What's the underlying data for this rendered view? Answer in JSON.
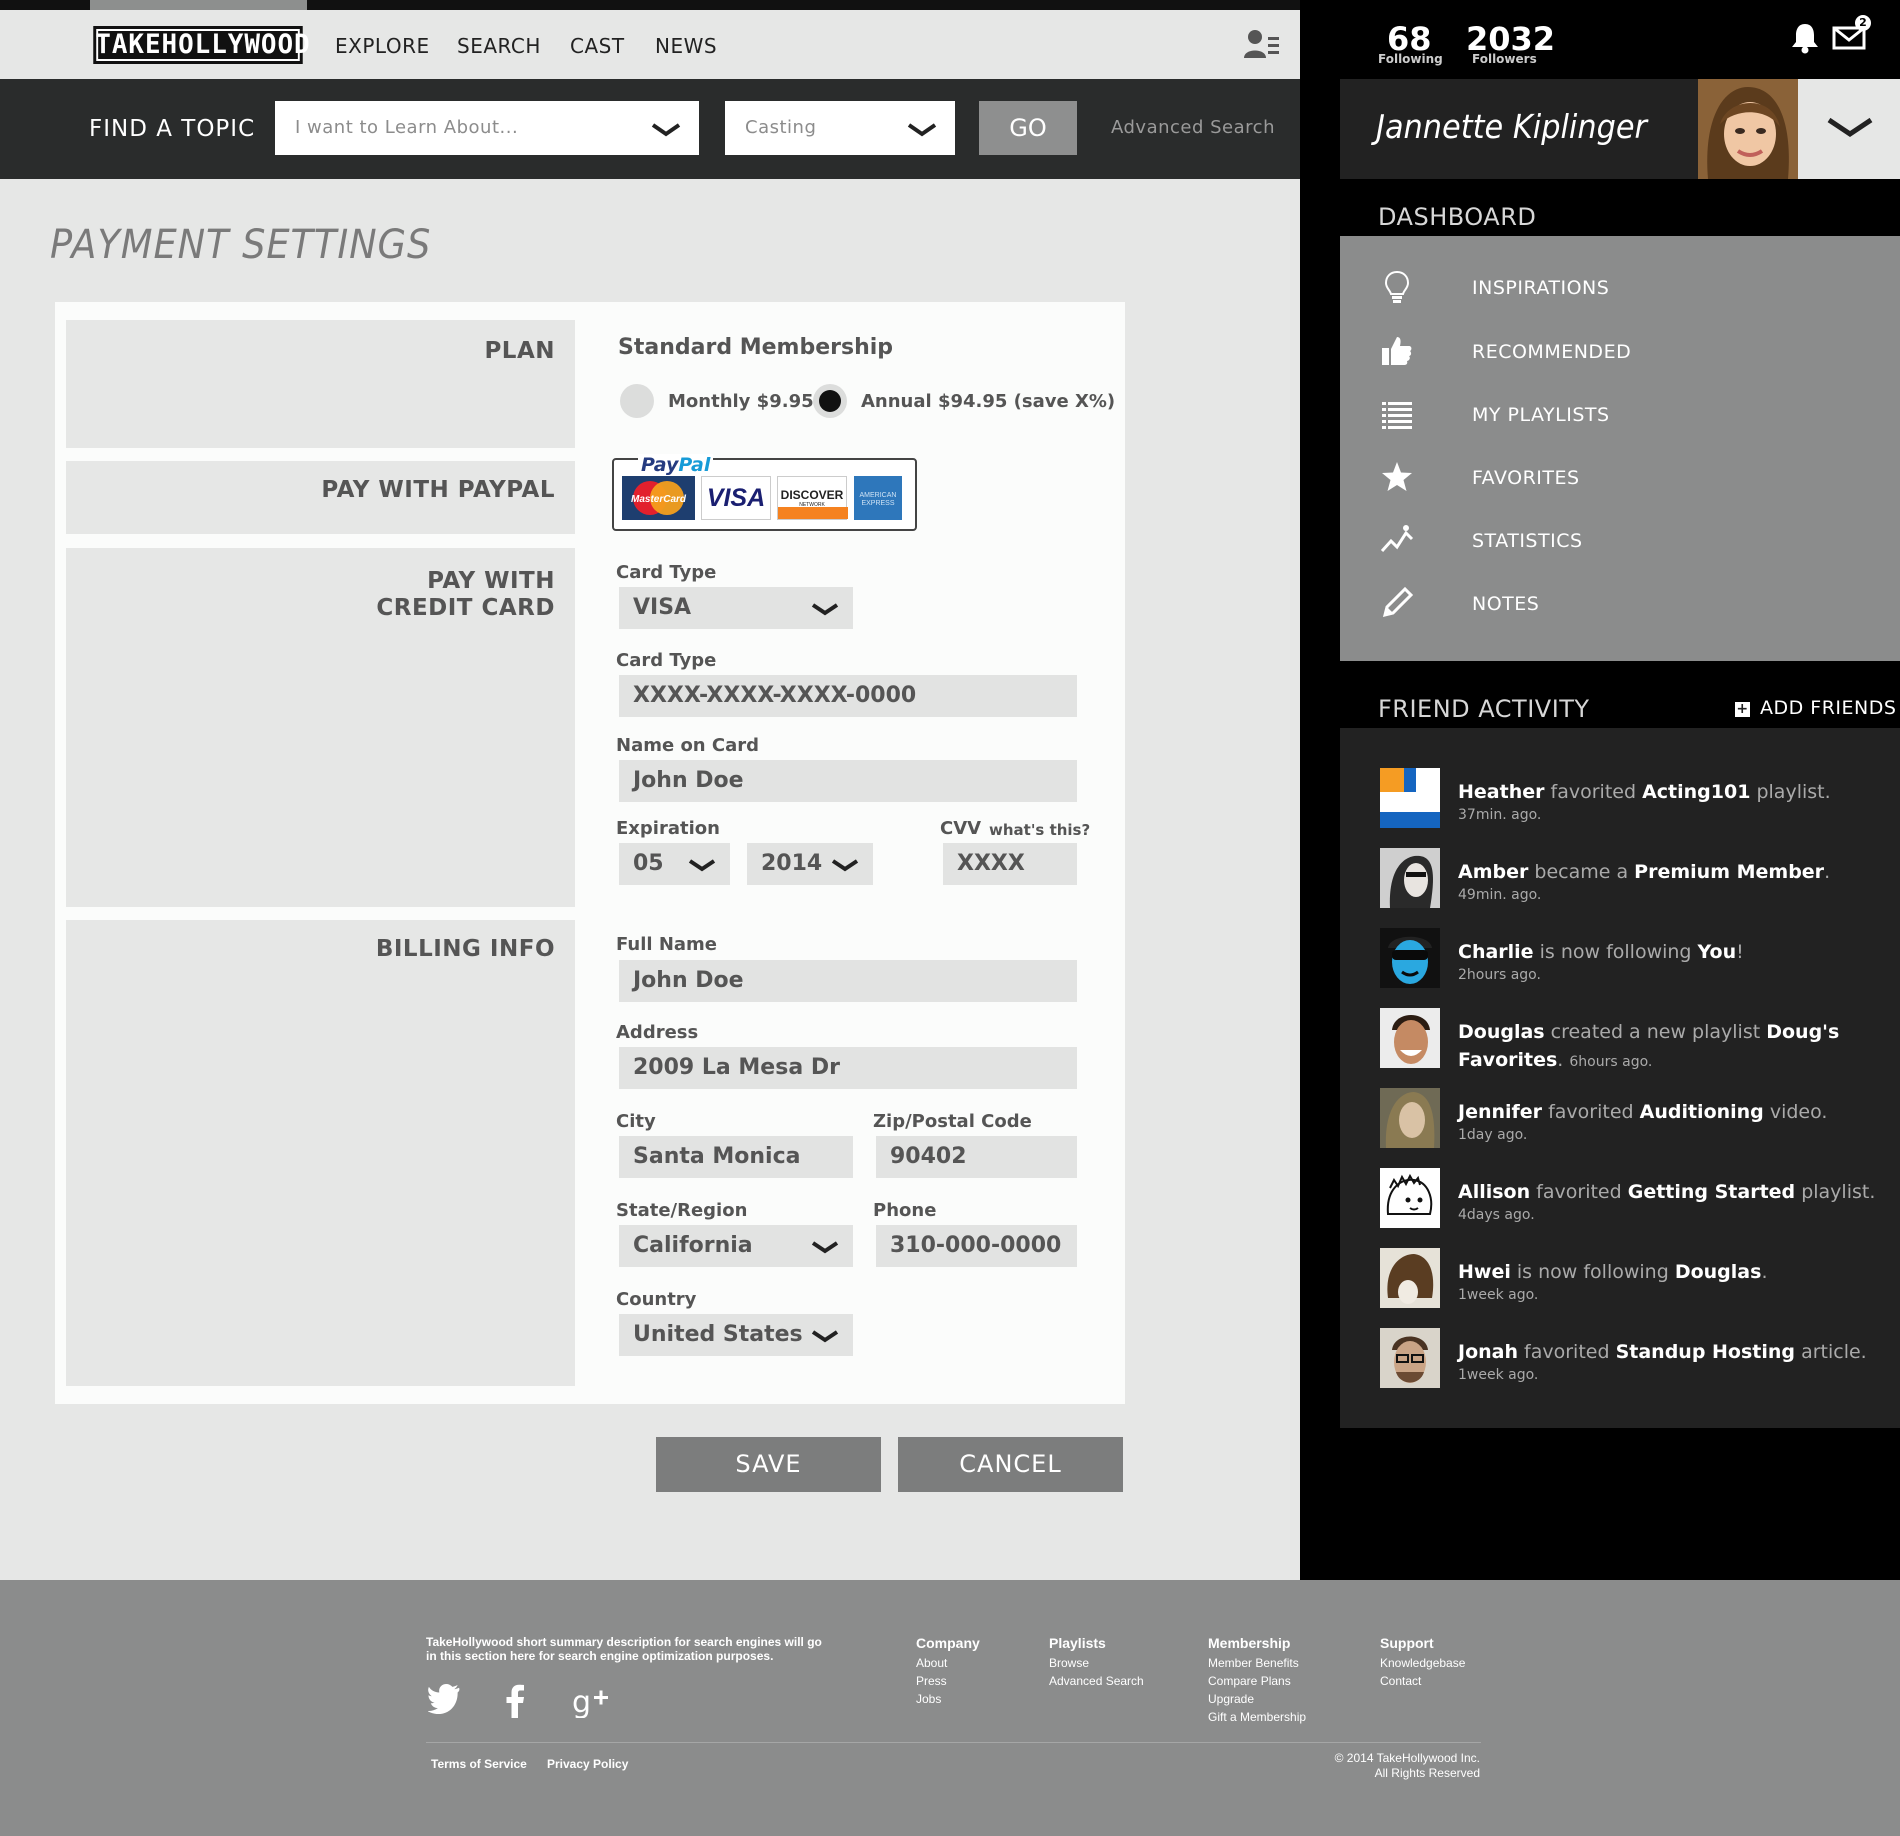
{
  "brand": {
    "logo": "TAKEHOLLYWOOD"
  },
  "nav": {
    "items": [
      "EXPLORE",
      "SEARCH",
      "CAST",
      "NEWS"
    ],
    "profile_icon": "user-list-icon"
  },
  "findbar": {
    "label": "FIND A TOPIC",
    "topic_placeholder": "I want to Learn About...",
    "category_value": "Casting",
    "go": "GO",
    "advanced": "Advanced Search"
  },
  "page": {
    "title": "PAYMENT SETTINGS"
  },
  "sections": {
    "plan": "PLAN",
    "paypal": "PAY WITH PAYPAL",
    "credit": [
      "PAY WITH",
      "CREDIT CARD"
    ],
    "billing": "BILLING INFO"
  },
  "plan": {
    "name": "Standard Membership",
    "options": [
      {
        "label": "Monthly $9.95",
        "selected": false
      },
      {
        "label": "Annual $94.95 (save X%)",
        "selected": true
      }
    ]
  },
  "paypal": {
    "brand_pay": "Pay",
    "brand_pal": "Pal",
    "cards": [
      {
        "name": "MasterCard",
        "icon": "mastercard-logo"
      },
      {
        "name": "VISA",
        "icon": "visa-logo"
      },
      {
        "name": "DISCOVER",
        "sub": "NETWORK",
        "icon": "discover-logo"
      },
      {
        "name": "AMERICAN EXPRESS",
        "icon": "amex-logo"
      }
    ]
  },
  "credit": {
    "card_type_label": "Card Type",
    "card_type_value": "VISA",
    "card_number_label": "Card Type",
    "card_number_value": "XXXX-XXXX-XXXX-0000",
    "name_label": "Name on Card",
    "name_value": "John Doe",
    "expiration_label": "Expiration",
    "exp_month": "05",
    "exp_year": "2014",
    "cvv_label": "CVV",
    "cvv_help": "what's this?",
    "cvv_value": "XXXX"
  },
  "billing": {
    "full_name_label": "Full Name",
    "full_name": "John Doe",
    "address_label": "Address",
    "address": "2009 La Mesa Dr",
    "city_label": "City",
    "city": "Santa Monica",
    "zip_label": "Zip/Postal Code",
    "zip": "90402",
    "state_label": "State/Region",
    "state": "California",
    "phone_label": "Phone",
    "phone": "310-000-0000",
    "country_label": "Country",
    "country": "United States"
  },
  "actions": {
    "save": "SAVE",
    "cancel": "CANCEL"
  },
  "profile": {
    "following_count": "68",
    "following_label": "Following",
    "followers_count": "2032",
    "followers_label": "Followers",
    "mail_badge": "2",
    "name": "Jannette Kiplinger"
  },
  "dashboard": {
    "title": "DASHBOARD",
    "items": [
      {
        "label": "INSPIRATIONS",
        "icon": "lightbulb-icon"
      },
      {
        "label": "RECOMMENDED",
        "icon": "thumbs-up-icon"
      },
      {
        "label": "MY PLAYLISTS",
        "icon": "list-icon"
      },
      {
        "label": "FAVORITES",
        "icon": "star-icon"
      },
      {
        "label": "STATISTICS",
        "icon": "trend-icon"
      },
      {
        "label": "NOTES",
        "icon": "pencil-icon"
      }
    ]
  },
  "friends": {
    "title": "FRIEND ACTIVITY",
    "add": "ADD FRIENDS",
    "activity": [
      {
        "user": "Heather",
        "verb": " favorited ",
        "object": "Acting101",
        "tail": " playlist.",
        "time": "37min. ago."
      },
      {
        "user": "Amber",
        "verb": " became a ",
        "object": "Premium Member",
        "tail": ".",
        "time": "49min. ago."
      },
      {
        "user": "Charlie",
        "verb": " is now following ",
        "object": "You",
        "tail": "!",
        "time": "2hours ago."
      },
      {
        "user": "Douglas",
        "verb": " created a new playlist ",
        "object": "Doug's Favorites",
        "tail": ".",
        "time": "6hours ago."
      },
      {
        "user": "Jennifer",
        "verb": " favorited ",
        "object": "Auditioning",
        "tail": " video.",
        "time": "1day ago."
      },
      {
        "user": "Allison",
        "verb": " favorited ",
        "object": "Getting Started",
        "tail": " playlist.",
        "time": "4days ago."
      },
      {
        "user": "Hwei",
        "verb": " is now following ",
        "object": "Douglas",
        "tail": ".",
        "time": "1week ago."
      },
      {
        "user": "Jonah",
        "verb": " favorited ",
        "object": "Standup Hosting",
        "tail": " article.",
        "time": "1week ago."
      }
    ]
  },
  "footer": {
    "description": "TakeHollywood short summary description for  search engines will go in this section here for search engine optimization purposes.",
    "social": [
      "twitter-icon",
      "facebook-icon",
      "google-plus-icon"
    ],
    "columns": [
      {
        "heading": "Company",
        "links": [
          "About",
          "Press",
          "Jobs"
        ]
      },
      {
        "heading": "Playlists",
        "links": [
          "Browse",
          "Advanced Search"
        ]
      },
      {
        "heading": "Membership",
        "links": [
          "Member Benefits",
          "Compare Plans",
          "Upgrade",
          "Gift a Membership"
        ]
      },
      {
        "heading": "Support",
        "links": [
          "Knowledgebase",
          "Contact"
        ]
      }
    ],
    "terms": "Terms of Service",
    "privacy": "Privacy Policy",
    "copyright_1": "© 2014 TakeHollywood Inc.",
    "copyright_2": "All Rights Reserved"
  },
  "colors": {
    "dark_bar": "#2a2c2c",
    "panel_gray": "#8b8c8c",
    "button_gray": "#7c7d7d",
    "page_bg": "#e6e7e6"
  }
}
